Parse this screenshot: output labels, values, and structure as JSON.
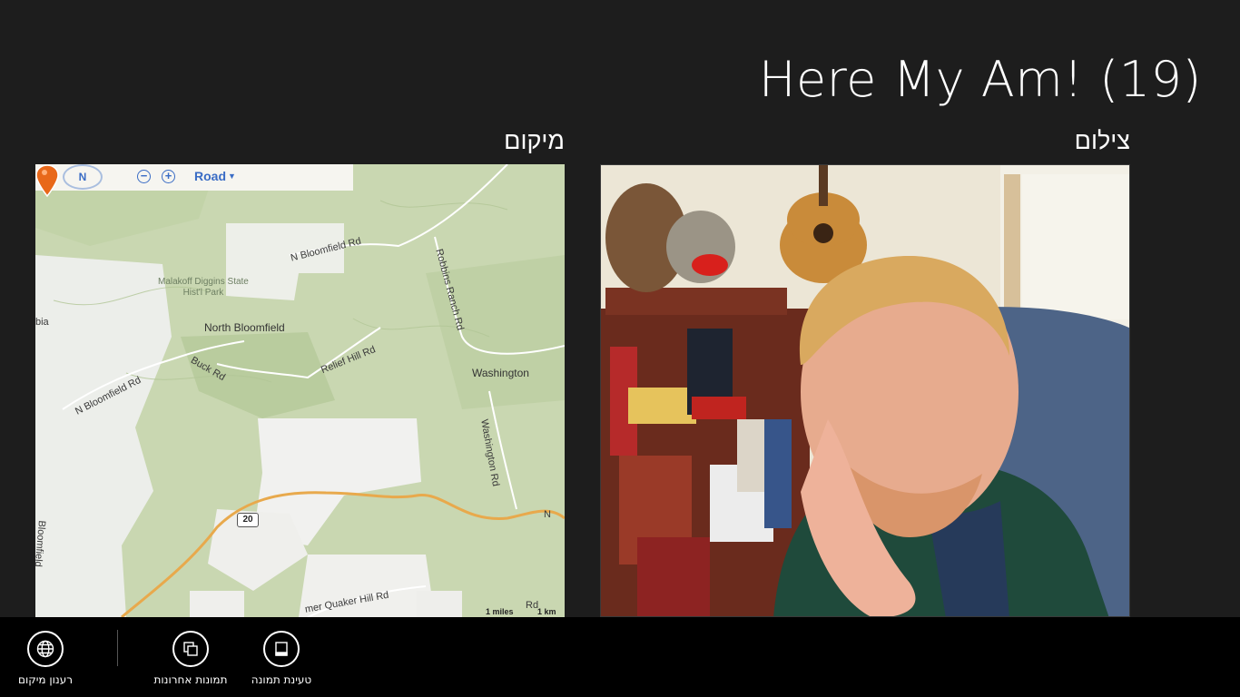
{
  "app": {
    "title": "Here My Am! (19)"
  },
  "sections": {
    "location_heading": "מיקום",
    "capture_heading": "צילום"
  },
  "map": {
    "compass_label": "N",
    "zoom_out": "−",
    "zoom_in": "+",
    "view_mode": "Road",
    "labels": {
      "n_bloomfield_rd": "N Bloomfield Rd",
      "park_line1": "Malakoff Diggins State",
      "park_line2": "Hist'l Park",
      "north_bloomfield": "North Bloomfield",
      "buck_rd": "Buck Rd",
      "relief_hill_rd": "Relief Hill Rd",
      "robbins_ranch_rd": "Robbins Ranch Rd",
      "washington": "Washington",
      "washington_rd": "Washington Rd",
      "nbloomfield_rd": "N Bloomfield Rd",
      "edge_bia": "bia",
      "edge_bloomfield": "Bloomfield",
      "quaker_hill_rd": "mer Quaker Hill Rd",
      "n_mark": "N",
      "rd_bottom": "Rd"
    },
    "highway_shield": "20",
    "scale_miles": "1 miles",
    "scale_km": "1 km",
    "pin_color": "#e8681a"
  },
  "appbar": {
    "buttons": [
      {
        "id": "refresh-location",
        "label": "רענון מיקום",
        "icon": "globe-icon"
      },
      {
        "id": "recent-pictures",
        "label": "תמונות אחרונות",
        "icon": "copy-pictures-icon"
      },
      {
        "id": "load-picture",
        "label": "טעינת תמונה",
        "icon": "picture-frame-icon"
      }
    ]
  },
  "colors": {
    "background": "#1d1d1d",
    "appbar": "#000000",
    "map_green": "#c9d7b1",
    "map_white": "#f3f3f0",
    "highway": "#e8a94c",
    "map_control_blue": "#3a6cc5"
  }
}
